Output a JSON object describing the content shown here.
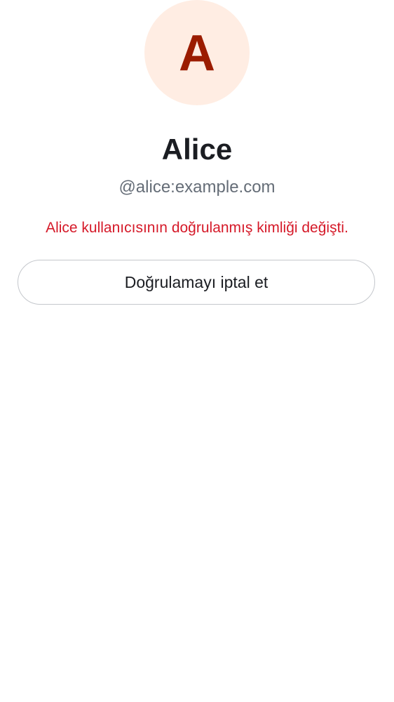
{
  "avatar": {
    "initial": "A",
    "background_color": "#ffede3",
    "letter_color": "#9b1c00"
  },
  "profile": {
    "display_name": "Alice",
    "user_id": "@alice:example.com"
  },
  "warning": {
    "text": "Alice kullanıcısının doğrulanmış kimliği değişti.",
    "color": "#d51928"
  },
  "actions": {
    "withdraw_verification_label": "Doğrulamayı iptal et"
  }
}
